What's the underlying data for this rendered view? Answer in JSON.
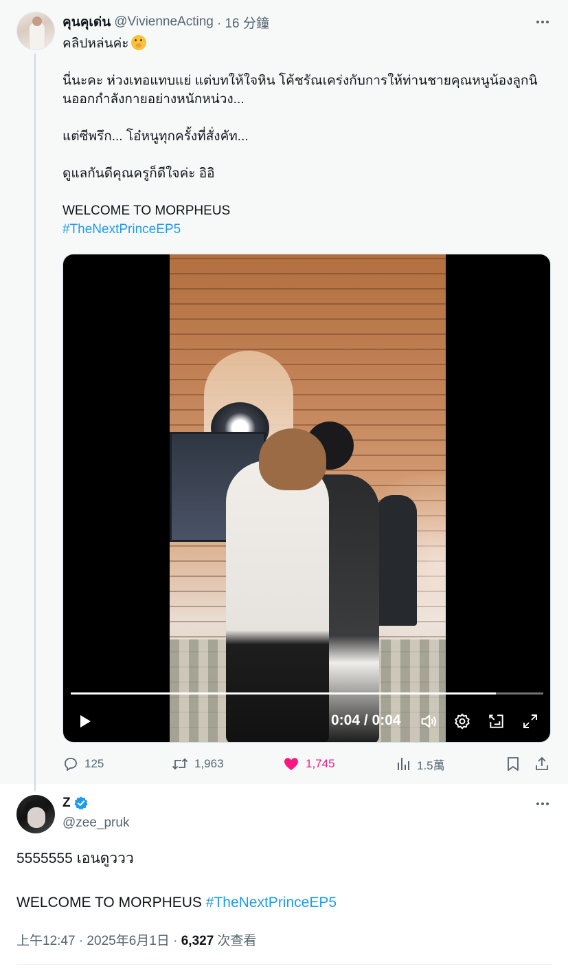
{
  "tweet1": {
    "display_name": "คุนคุเด่น",
    "handle": "@VivienneActing",
    "time": "· 16 分鐘",
    "lines": [
      "คลิปหล่นค่ะ",
      "นี่นะคะ ห่วงเทอแทบแย่ แต่บทให้ใจหิน โค้ชรัณเคร่งกับการให้ท่านชายคุณหนูน้องลูกนิ",
      "นออกกำลังกายอย่างหนักหน่วง...",
      "แต่ซีพรึก... โอ๋หนูทุกครั้งที่สั่งคัท...",
      "ดูแลกันดีคุณครูก็ดีใจค่ะ อิอิ",
      "WELCOME TO MORPHEUS"
    ],
    "hashtag": "#TheNextPrinceEP5",
    "emoji": "shushing-face-emoji",
    "video": {
      "time_display": "0:04 / 0:04",
      "progress": 0.9,
      "controls": [
        "play-icon",
        "volume-icon",
        "settings-icon",
        "pip-icon",
        "fullscreen-icon"
      ]
    },
    "actions": {
      "replies": "125",
      "reposts": "1,963",
      "likes": "1,745",
      "views": "1.5萬"
    }
  },
  "tweet2": {
    "display_name": "Z",
    "handle": "@zee_pruk",
    "text_line1": "5555555 เอนดูววว",
    "text_line2": "WELCOME TO MORPHEUS ",
    "hashtag": "#TheNextPrinceEP5",
    "meta_time": "上午12:47 · 2025年6月1日 · ",
    "views_count": "6,327",
    "views_label": " 次查看"
  },
  "colors": {
    "accent": "#1d9bf0",
    "like": "#f91880",
    "muted": "#536471",
    "text": "#0f1419"
  }
}
